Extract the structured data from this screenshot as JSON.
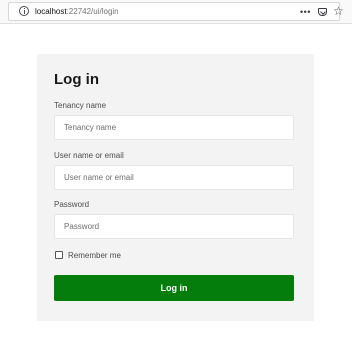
{
  "browser": {
    "url_host": "localhost",
    "url_rest": ":22742/ui/login",
    "more_label": "•••",
    "star_label": "☆"
  },
  "login": {
    "title": "Log in",
    "tenancy_label": "Tenancy name",
    "tenancy_placeholder": "Tenancy name",
    "username_label": "User name or email",
    "username_placeholder": "User name or email",
    "password_label": "Password",
    "password_placeholder": "Password",
    "remember_label": "Remember me",
    "submit_label": "Log in"
  },
  "colors": {
    "button_bg": "#047d0c",
    "card_bg": "#f3f3f3"
  }
}
